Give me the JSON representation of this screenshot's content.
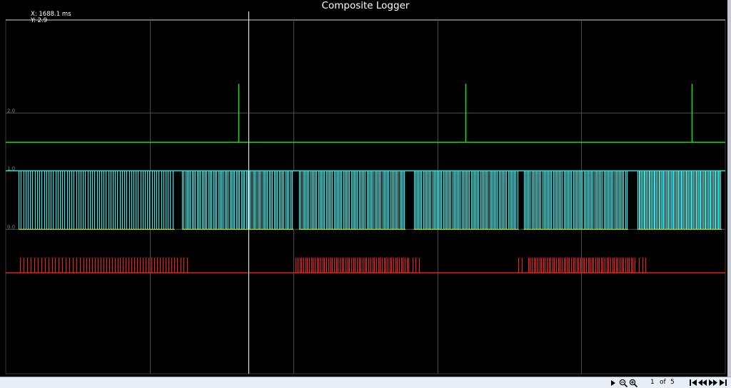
{
  "window": {
    "title": "Composite Logger"
  },
  "cursor": {
    "x_readout": "X: 1688.1 ms",
    "y_readout": "Y: 2.9",
    "x_value": 1688.1,
    "y_value": 2.9
  },
  "pager": {
    "current": "1",
    "of_label": "of",
    "total": "5"
  },
  "icons": {
    "play": "play-triangle-icon",
    "zoom_out": "zoom-out-icon",
    "zoom_in": "zoom-in-icon",
    "first": "first-page-icon",
    "prev": "previous-page-icon",
    "next": "next-page-icon",
    "last": "last-page-icon"
  },
  "chart_data": {
    "type": "line",
    "title": "Composite Logger",
    "xlabel": "",
    "ylabel": "",
    "x_unit": "ms",
    "xlim": [
      0,
      5000
    ],
    "ylim": [
      -2.5,
      3.6
    ],
    "grid": true,
    "y_ticks": [
      {
        "value": 2.0,
        "label": "2.0"
      },
      {
        "value": 1.0,
        "label": "1.0"
      },
      {
        "value": 0.0,
        "label": "0.0"
      }
    ],
    "series": [
      {
        "key": "green",
        "color": "#22dd22",
        "style": "pulses",
        "base": 1.5,
        "high": 2.5,
        "pulses": [
          1615,
          3195,
          4765
        ]
      },
      {
        "key": "cyan",
        "color": "#33e6e6",
        "style": "pulse_train",
        "base": 0.0,
        "high": 1.0,
        "pulses_per_group": 68,
        "groups": [
          [
            90,
            1175
          ],
          [
            1225,
            2000
          ],
          [
            2040,
            2780
          ],
          [
            2835,
            3565
          ],
          [
            3600,
            4325
          ],
          [
            4390,
            4975
          ]
        ],
        "gaps": [
          [
            1175,
            1225
          ],
          [
            2000,
            2040
          ],
          [
            2780,
            2835
          ],
          [
            3565,
            3600
          ],
          [
            4325,
            4390
          ]
        ]
      },
      {
        "key": "red",
        "color": "#ee2222",
        "style": "pulse_train",
        "base": -0.75,
        "high": -0.5,
        "groups": [
          {
            "start": 100,
            "end": 1190,
            "pulses": 52,
            "dense_from": 540
          },
          {
            "start": 1215,
            "end": 1260,
            "pulses": 3
          },
          {
            "start": 2015,
            "end": 2800,
            "pulses": 60
          },
          {
            "start": 2825,
            "end": 2870,
            "pulses": 3
          },
          {
            "start": 3560,
            "end": 3585,
            "pulses": 2
          },
          {
            "start": 3630,
            "end": 4370,
            "pulses": 58
          },
          {
            "start": 4400,
            "end": 4445,
            "pulses": 3
          }
        ]
      }
    ]
  }
}
